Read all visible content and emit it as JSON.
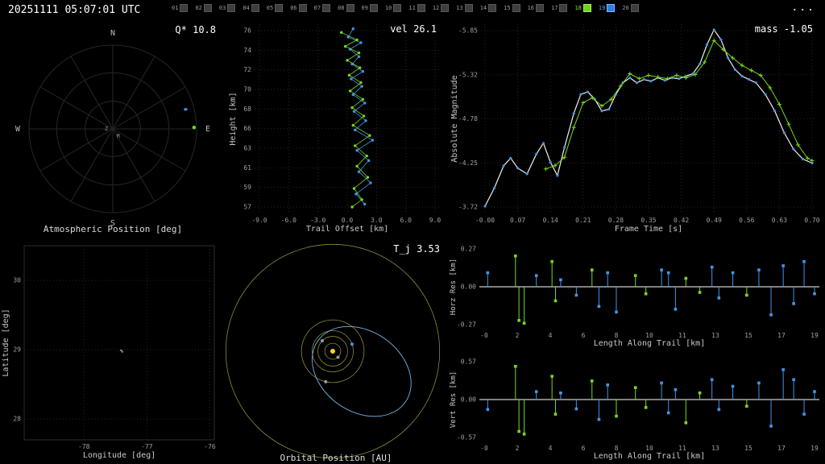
{
  "topbar": {
    "timestamp": "20251111 05:07:01 UTC",
    "menu_label": "...",
    "frames": [
      {
        "id": "01",
        "state": "normal"
      },
      {
        "id": "02",
        "state": "normal"
      },
      {
        "id": "03",
        "state": "normal"
      },
      {
        "id": "04",
        "state": "normal"
      },
      {
        "id": "05",
        "state": "normal"
      },
      {
        "id": "06",
        "state": "normal"
      },
      {
        "id": "07",
        "state": "normal"
      },
      {
        "id": "08",
        "state": "normal"
      },
      {
        "id": "09",
        "state": "normal"
      },
      {
        "id": "10",
        "state": "normal"
      },
      {
        "id": "11",
        "state": "normal"
      },
      {
        "id": "12",
        "state": "normal"
      },
      {
        "id": "13",
        "state": "normal"
      },
      {
        "id": "14",
        "state": "normal"
      },
      {
        "id": "15",
        "state": "normal"
      },
      {
        "id": "16",
        "state": "normal"
      },
      {
        "id": "17",
        "state": "normal"
      },
      {
        "id": "18",
        "state": "green"
      },
      {
        "id": "19",
        "state": "blue"
      },
      {
        "id": "20",
        "state": "normal"
      }
    ]
  },
  "colors": {
    "green": "#79d71f",
    "blue": "#4494e4",
    "white": "#f0f0f0",
    "grid": "#262626",
    "tick": "#a0a0a0",
    "label": "#c8c8c8",
    "olive": "#8b8b3a",
    "sun": "#ffd21f",
    "grey": "#9a9a9a"
  },
  "chart_data": [
    {
      "id": "atmospheric_position",
      "type": "scatter",
      "title": "Atmospheric Position [deg]",
      "annotation": "Q* 10.8",
      "direction_labels": [
        "N",
        "E",
        "S",
        "W"
      ],
      "center_labels": [
        "Z",
        "R"
      ],
      "rings": [
        0.33,
        0.67,
        1.0
      ],
      "spoke_step_deg": 30,
      "points": [
        {
          "azim_deg": 75,
          "r": 0.9,
          "color": "blue",
          "marker": "square"
        },
        {
          "azim_deg": 89,
          "r": 0.97,
          "color": "green",
          "marker": "circle"
        }
      ]
    },
    {
      "id": "trail_offset",
      "type": "line",
      "annotation": "vel 26.1",
      "xlabel": "Trail Offset [km]",
      "ylabel": "Height [km]",
      "x_ticks": [
        "-9.0",
        "-6.0",
        "-3.0",
        "0.0",
        "3.0",
        "6.0",
        "9.0"
      ],
      "y_ticks": [
        "76",
        "74",
        "72",
        "70",
        "68",
        "66",
        "63",
        "61",
        "59",
        "57"
      ],
      "series": [
        {
          "name": "station_blue",
          "color": "blue",
          "marker": "circle",
          "points": [
            [
              0.6,
              76.2
            ],
            [
              0.1,
              75.3
            ],
            [
              1.4,
              74.7
            ],
            [
              0.3,
              74.0
            ],
            [
              1.2,
              73.2
            ],
            [
              0.5,
              72.4
            ],
            [
              1.6,
              71.6
            ],
            [
              0.4,
              70.8
            ],
            [
              1.5,
              70.0
            ],
            [
              0.6,
              69.1
            ],
            [
              1.8,
              68.2
            ],
            [
              0.7,
              67.3
            ],
            [
              1.9,
              66.3
            ],
            [
              0.8,
              65.3
            ],
            [
              2.6,
              64.2
            ],
            [
              1.0,
              63.1
            ],
            [
              2.2,
              62.0
            ],
            [
              1.2,
              60.8
            ],
            [
              2.4,
              59.6
            ],
            [
              0.9,
              58.4
            ],
            [
              1.8,
              57.3
            ]
          ]
        },
        {
          "name": "station_green",
          "color": "green",
          "marker": "circle",
          "points": [
            [
              -0.6,
              75.8
            ],
            [
              1.0,
              75.0
            ],
            [
              -0.2,
              74.3
            ],
            [
              1.2,
              73.6
            ],
            [
              0.0,
              72.8
            ],
            [
              1.3,
              72.0
            ],
            [
              0.2,
              71.2
            ],
            [
              1.4,
              70.4
            ],
            [
              0.3,
              69.5
            ],
            [
              1.6,
              68.6
            ],
            [
              0.5,
              67.7
            ],
            [
              1.7,
              66.8
            ],
            [
              0.6,
              65.8
            ],
            [
              2.3,
              64.7
            ],
            [
              0.8,
              63.6
            ],
            [
              2.0,
              62.5
            ],
            [
              1.0,
              61.4
            ],
            [
              2.1,
              60.2
            ],
            [
              0.7,
              59.0
            ],
            [
              1.5,
              57.8
            ],
            [
              0.5,
              57.0
            ]
          ]
        }
      ]
    },
    {
      "id": "light_curve",
      "type": "line",
      "annotation": "mass -1.05",
      "xlabel": "Frame Time [s]",
      "ylabel": "Absolute Magnitude",
      "x_ticks": [
        "-0.00",
        "0.07",
        "0.14",
        "0.21",
        "0.28",
        "0.35",
        "0.42",
        "0.49",
        "0.56",
        "0.63",
        "0.70"
      ],
      "y_ticks": [
        "-5.85",
        "-5.32",
        "-4.78",
        "-4.25",
        "-3.72"
      ],
      "series": [
        {
          "name": "fit_station_blue",
          "color": "white",
          "marker": "circle",
          "marker_color": "blue",
          "points": [
            [
              0.0,
              -3.73
            ],
            [
              0.02,
              -3.95
            ],
            [
              0.04,
              -4.22
            ],
            [
              0.055,
              -4.31
            ],
            [
              0.07,
              -4.19
            ],
            [
              0.09,
              -4.12
            ],
            [
              0.11,
              -4.36
            ],
            [
              0.125,
              -4.49
            ],
            [
              0.14,
              -4.26
            ],
            [
              0.155,
              -4.1
            ],
            [
              0.17,
              -4.44
            ],
            [
              0.19,
              -4.85
            ],
            [
              0.205,
              -5.08
            ],
            [
              0.22,
              -5.11
            ],
            [
              0.235,
              -5.02
            ],
            [
              0.25,
              -4.88
            ],
            [
              0.265,
              -4.9
            ],
            [
              0.28,
              -5.08
            ],
            [
              0.295,
              -5.22
            ],
            [
              0.31,
              -5.28
            ],
            [
              0.325,
              -5.22
            ],
            [
              0.34,
              -5.26
            ],
            [
              0.355,
              -5.24
            ],
            [
              0.37,
              -5.28
            ],
            [
              0.385,
              -5.25
            ],
            [
              0.4,
              -5.28
            ],
            [
              0.415,
              -5.27
            ],
            [
              0.43,
              -5.3
            ],
            [
              0.445,
              -5.33
            ],
            [
              0.46,
              -5.45
            ],
            [
              0.475,
              -5.68
            ],
            [
              0.49,
              -5.86
            ],
            [
              0.505,
              -5.74
            ],
            [
              0.52,
              -5.52
            ],
            [
              0.535,
              -5.38
            ],
            [
              0.55,
              -5.3
            ],
            [
              0.565,
              -5.26
            ],
            [
              0.58,
              -5.22
            ],
            [
              0.6,
              -5.08
            ],
            [
              0.62,
              -4.88
            ],
            [
              0.64,
              -4.62
            ],
            [
              0.66,
              -4.42
            ],
            [
              0.68,
              -4.3
            ],
            [
              0.7,
              -4.25
            ]
          ]
        },
        {
          "name": "station_green",
          "color": "green",
          "marker": "plus",
          "points": [
            [
              0.13,
              -4.18
            ],
            [
              0.15,
              -4.22
            ],
            [
              0.17,
              -4.32
            ],
            [
              0.19,
              -4.68
            ],
            [
              0.21,
              -4.98
            ],
            [
              0.23,
              -5.04
            ],
            [
              0.25,
              -4.94
            ],
            [
              0.27,
              -5.02
            ],
            [
              0.29,
              -5.18
            ],
            [
              0.31,
              -5.33
            ],
            [
              0.33,
              -5.27
            ],
            [
              0.35,
              -5.31
            ],
            [
              0.37,
              -5.29
            ],
            [
              0.39,
              -5.27
            ],
            [
              0.41,
              -5.31
            ],
            [
              0.43,
              -5.28
            ],
            [
              0.45,
              -5.32
            ],
            [
              0.47,
              -5.47
            ],
            [
              0.49,
              -5.73
            ],
            [
              0.51,
              -5.62
            ],
            [
              0.53,
              -5.52
            ],
            [
              0.55,
              -5.43
            ],
            [
              0.57,
              -5.37
            ],
            [
              0.59,
              -5.31
            ],
            [
              0.61,
              -5.16
            ],
            [
              0.63,
              -4.96
            ],
            [
              0.65,
              -4.72
            ],
            [
              0.67,
              -4.47
            ],
            [
              0.69,
              -4.31
            ],
            [
              0.7,
              -4.28
            ]
          ]
        }
      ]
    },
    {
      "id": "ground_track",
      "type": "scatter",
      "xlabel": "Longitude [deg]",
      "ylabel": "Latitude [deg]",
      "x_ticks": [
        "-78",
        "-77",
        "-76"
      ],
      "y_ticks": [
        "30",
        "29",
        "28"
      ],
      "x_range": [
        -78.95,
        -75.93
      ],
      "y_range": [
        30.5,
        27.7
      ],
      "points": [
        {
          "lon": -77.41,
          "lat": 28.99,
          "color": "green"
        },
        {
          "lon": -77.39,
          "lat": 28.97,
          "color": "blue"
        }
      ]
    },
    {
      "id": "orbital_position",
      "type": "scatter",
      "title": "Orbital Position [AU]",
      "annotation": "T_j 3.53",
      "planet_orbits_au": [
        0.387,
        0.723,
        1.0,
        1.524,
        5.203
      ],
      "meteoroid_orbit": {
        "a_au": 2.6,
        "e": 0.66,
        "rot_deg": 35
      },
      "bodies": [
        {
          "name": "earth",
          "r_au": 1.0,
          "angle_deg": -20,
          "color": "blue"
        },
        {
          "name": "venus",
          "r_au": 0.723,
          "angle_deg": 225,
          "color": "grey"
        },
        {
          "name": "mars",
          "r_au": 1.524,
          "angle_deg": 103,
          "color": "grey"
        },
        {
          "name": "mercury",
          "r_au": 0.387,
          "angle_deg": 49,
          "color": "grey"
        }
      ]
    },
    {
      "id": "horz_residuals",
      "type": "bar",
      "xlabel": "Length Along Trail [km]",
      "ylabel": "Horz Res [km]",
      "x_ticks": [
        "-0",
        "2",
        "4",
        "6",
        "8",
        "10",
        "11",
        "13",
        "15",
        "17",
        "19"
      ],
      "y_ticks": [
        "0.27",
        "0.00",
        "-0.27"
      ],
      "stems": [
        [
          0.2,
          0.1,
          "b"
        ],
        [
          1.8,
          0.22,
          "g"
        ],
        [
          2.0,
          -0.24,
          "g"
        ],
        [
          2.3,
          -0.26,
          "g"
        ],
        [
          3.0,
          0.08,
          "b"
        ],
        [
          3.9,
          0.18,
          "g"
        ],
        [
          4.1,
          -0.1,
          "g"
        ],
        [
          4.4,
          0.05,
          "b"
        ],
        [
          5.3,
          -0.06,
          "b"
        ],
        [
          6.2,
          0.12,
          "g"
        ],
        [
          6.6,
          -0.14,
          "b"
        ],
        [
          7.1,
          0.1,
          "b"
        ],
        [
          7.6,
          -0.18,
          "b"
        ],
        [
          8.7,
          0.08,
          "g"
        ],
        [
          9.3,
          -0.05,
          "g"
        ],
        [
          10.2,
          0.12,
          "b"
        ],
        [
          10.6,
          0.1,
          "b"
        ],
        [
          11.0,
          -0.16,
          "b"
        ],
        [
          11.6,
          0.06,
          "g"
        ],
        [
          12.4,
          -0.04,
          "g"
        ],
        [
          13.1,
          0.14,
          "b"
        ],
        [
          13.5,
          -0.08,
          "b"
        ],
        [
          14.3,
          0.1,
          "b"
        ],
        [
          15.1,
          -0.06,
          "g"
        ],
        [
          15.8,
          0.12,
          "b"
        ],
        [
          16.5,
          -0.2,
          "b"
        ],
        [
          17.2,
          0.15,
          "b"
        ],
        [
          17.8,
          -0.12,
          "b"
        ],
        [
          18.4,
          0.18,
          "b"
        ],
        [
          19.0,
          -0.05,
          "b"
        ]
      ]
    },
    {
      "id": "vert_residuals",
      "type": "bar",
      "xlabel": "Length Along Trail [km]",
      "ylabel": "Vert Res [km]",
      "x_ticks": [
        "-0",
        "2",
        "4",
        "6",
        "8",
        "10",
        "11",
        "13",
        "15",
        "17",
        "19"
      ],
      "y_ticks": [
        "0.57",
        "0.00",
        "-0.57"
      ],
      "stems": [
        [
          0.2,
          -0.15,
          "b"
        ],
        [
          1.8,
          0.5,
          "g"
        ],
        [
          2.0,
          -0.48,
          "g"
        ],
        [
          2.3,
          -0.52,
          "g"
        ],
        [
          3.0,
          0.12,
          "b"
        ],
        [
          3.9,
          0.35,
          "g"
        ],
        [
          4.1,
          -0.22,
          "g"
        ],
        [
          4.4,
          0.1,
          "b"
        ],
        [
          5.3,
          -0.14,
          "b"
        ],
        [
          6.2,
          0.28,
          "g"
        ],
        [
          6.6,
          -0.3,
          "b"
        ],
        [
          7.1,
          0.22,
          "b"
        ],
        [
          7.6,
          -0.25,
          "g"
        ],
        [
          8.7,
          0.18,
          "g"
        ],
        [
          9.3,
          -0.12,
          "g"
        ],
        [
          10.2,
          0.25,
          "b"
        ],
        [
          10.6,
          -0.2,
          "b"
        ],
        [
          11.0,
          0.15,
          "b"
        ],
        [
          11.6,
          -0.35,
          "g"
        ],
        [
          12.4,
          0.1,
          "g"
        ],
        [
          13.1,
          0.3,
          "b"
        ],
        [
          13.5,
          -0.15,
          "b"
        ],
        [
          14.3,
          0.2,
          "b"
        ],
        [
          15.1,
          -0.1,
          "g"
        ],
        [
          15.8,
          0.25,
          "b"
        ],
        [
          16.5,
          -0.4,
          "b"
        ],
        [
          17.2,
          0.45,
          "b"
        ],
        [
          17.8,
          0.3,
          "b"
        ],
        [
          18.4,
          -0.22,
          "b"
        ],
        [
          19.0,
          0.12,
          "b"
        ]
      ]
    }
  ]
}
